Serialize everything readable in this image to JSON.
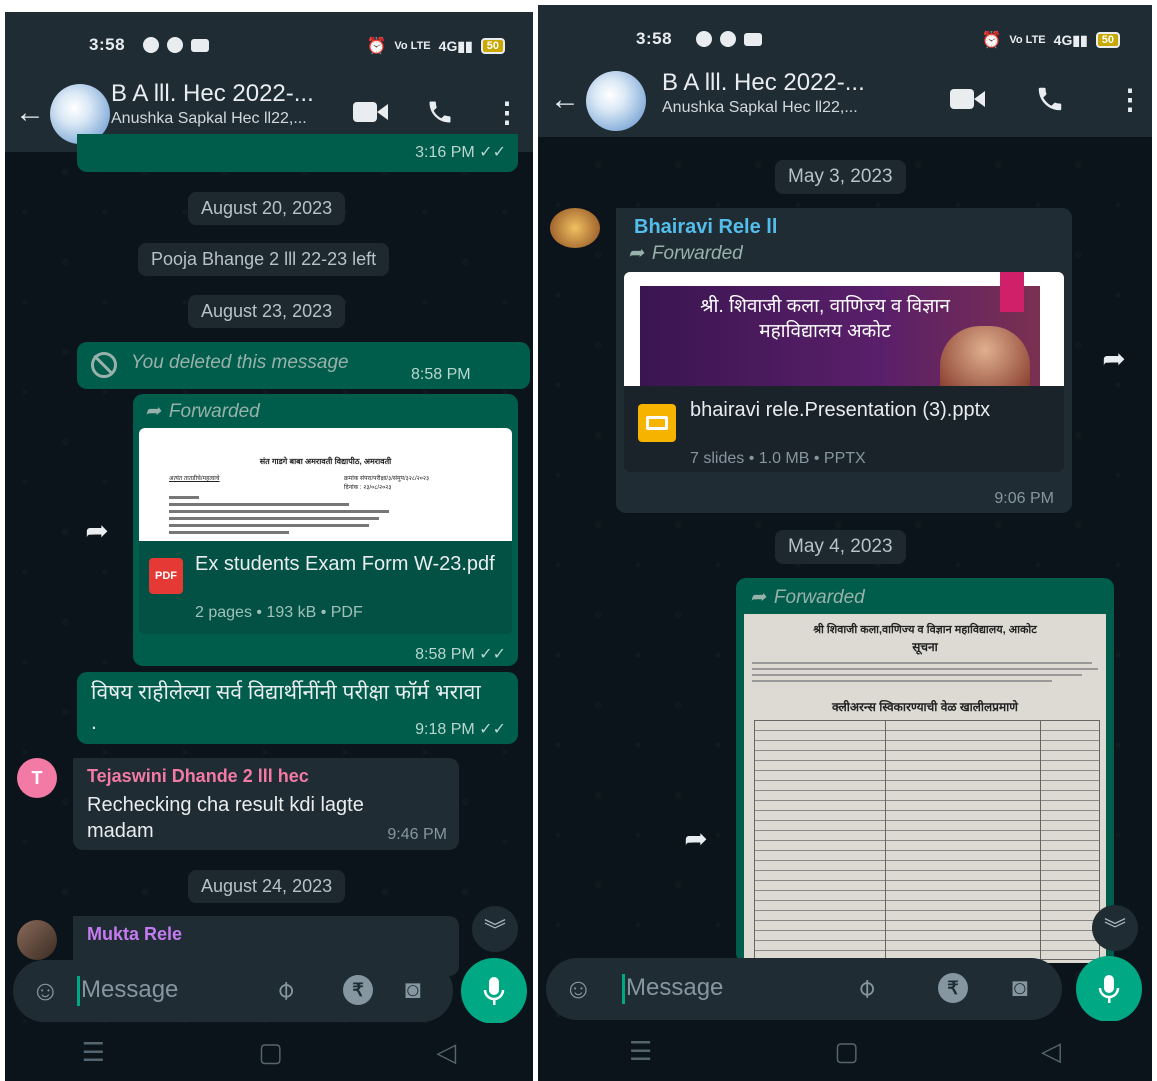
{
  "left": {
    "status": {
      "time": "3:58",
      "battery": "50"
    },
    "header": {
      "title": "B A lll. Hec 2022-...",
      "subtitle": "Anushka Sapkal Hec ll22,..."
    },
    "top_bubble_time": "3:16 PM",
    "dates": {
      "d1": "August 20, 2023",
      "d2": "August 23, 2023",
      "d3": "August 24, 2023"
    },
    "system_msg": "Pooja Bhange 2 lll 22-23 left",
    "deleted": {
      "text": "You deleted this message",
      "time": "8:58 PM"
    },
    "forwarded_pdf": {
      "forwarded_label": "Forwarded",
      "doc_heading": "संत गाडगे बाबा अमरावती विद्यापीठ, अमरावती",
      "doc_ref_left": "अत्यंत तातडीचे/महत्वाचे",
      "doc_ref_right": "क्रमांक संपरा/परीक्षा/३/संमुप/३२८/२०२३",
      "doc_date": "दिनांक : २३/०८/२०२३",
      "file_name": "Ex students Exam Form W-23.pdf",
      "file_info": "2 pages • 193 kB • PDF",
      "pdf_badge": "PDF",
      "time": "8:58 PM"
    },
    "marathi_msg": {
      "text": "विषय राहीलेल्या सर्व विद्यार्थीनींनी परीक्षा फॉर्म भरावा .",
      "time": "9:18 PM"
    },
    "incoming": {
      "sender": "Tejaswini Dhande 2 lll hec",
      "initial": "T",
      "text": "Rechecking cha result kdi lagte madam",
      "time": "9:46 PM"
    },
    "incoming2": {
      "sender": "Mukta Rele"
    },
    "composer": {
      "placeholder": "Message"
    }
  },
  "right": {
    "status": {
      "time": "3:58",
      "battery": "50"
    },
    "header": {
      "title": "B A lll. Hec 2022-...",
      "subtitle": "Anushka Sapkal Hec ll22,..."
    },
    "dates": {
      "d1": "May 3, 2023",
      "d2": "May 4, 2023"
    },
    "ppt_msg": {
      "sender": "Bhairavi Rele ll",
      "forwarded_label": "Forwarded",
      "slide_title": "श्री. शिवाजी कला, वाणिज्य व विज्ञान महाविद्यालय अकोट",
      "file_name": "bhairavi rele.Presentation (3).pptx",
      "file_info": "7 slides • 1.0 MB • PPTX",
      "time": "9:06 PM"
    },
    "photo_msg": {
      "forwarded_label": "Forwarded",
      "photo_heading": "श्री शिवाजी कला,वाणिज्य व विज्ञान महाविद्यालय, आकोट",
      "photo_notice": "सूचना",
      "photo_sub": "क्लीअरन्स स्विकारण्याची वेळ खालीलप्रमाणे"
    },
    "composer": {
      "placeholder": "Message"
    }
  },
  "colors": {
    "outgoing": "#005c4b",
    "incoming": "#202c33",
    "accent": "#00a884",
    "background": "#0b141a",
    "bar": "#1f2c34"
  }
}
